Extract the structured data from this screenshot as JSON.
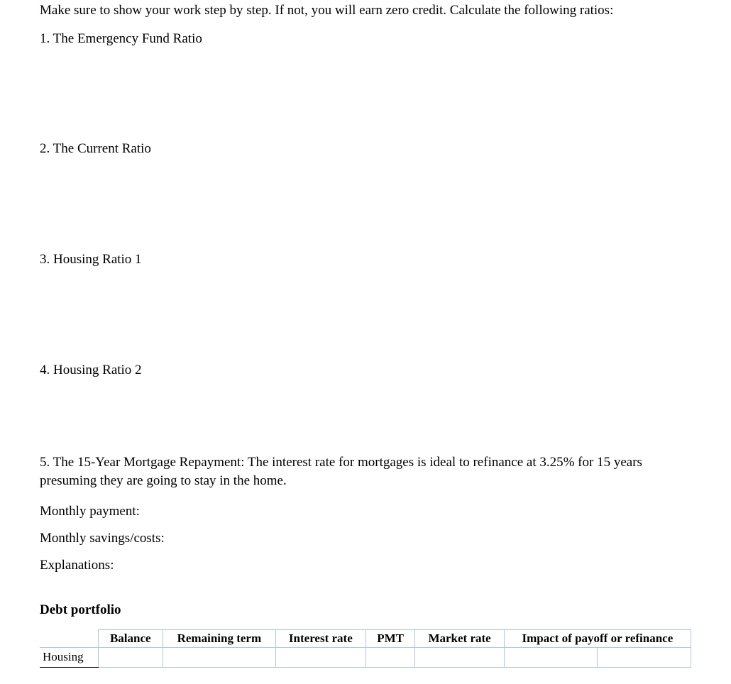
{
  "intro": "Make sure to show your work step by step. If not, you will earn zero credit. Calculate the following ratios:",
  "q1": "1. The Emergency Fund Ratio",
  "q2": "2. The Current Ratio",
  "q3": "3. Housing Ratio 1",
  "q4": "4. Housing Ratio 2",
  "q5": "5. The 15-Year Mortgage Repayment: The interest rate for mortgages is ideal to refinance at 3.25% for 15 years presuming they are going to stay in the home.",
  "q5_monthly_payment": "Monthly payment:",
  "q5_monthly_savings": "Monthly savings/costs:",
  "q5_explanations": "Explanations:",
  "debt_portfolio_heading": "Debt portfolio",
  "table": {
    "headers": [
      "Balance",
      "Remaining term",
      "Interest rate",
      "PMT",
      "Market rate",
      "Impact of payoff or refinance"
    ],
    "row_label": "Housing"
  }
}
